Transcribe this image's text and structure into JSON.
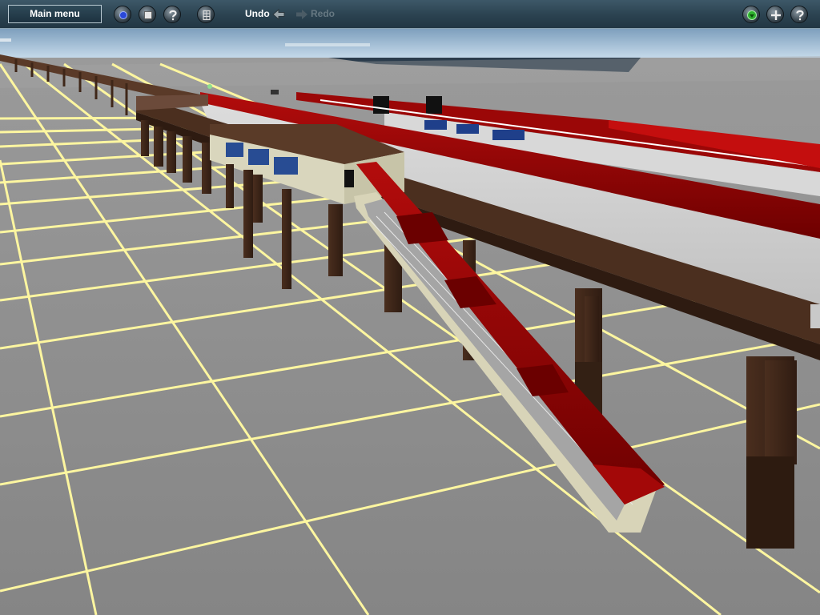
{
  "toolbar": {
    "main_menu_label": "Main menu",
    "undo_label": "Undo",
    "redo_label": "Redo"
  },
  "colors": {
    "toolbar_bg": "#2b4250",
    "roof_red": "#8c0000",
    "pillar_brown": "#3b2418",
    "ground_gray": "#8d8d8d",
    "grid_yellow": "#fdf6a0",
    "sky_blue": "#b9d2e6",
    "green_button": "#2fb02f"
  },
  "icons": {
    "tool_1": "blue-dot-icon",
    "tool_2": "square-icon",
    "tool_3": "question-icon",
    "tool_4": "grid-icon",
    "undo": "arrow-left-icon",
    "redo": "arrow-right-icon",
    "right_1": "green-dot-icon",
    "right_2": "plus-icon",
    "right_3": "help-icon"
  }
}
